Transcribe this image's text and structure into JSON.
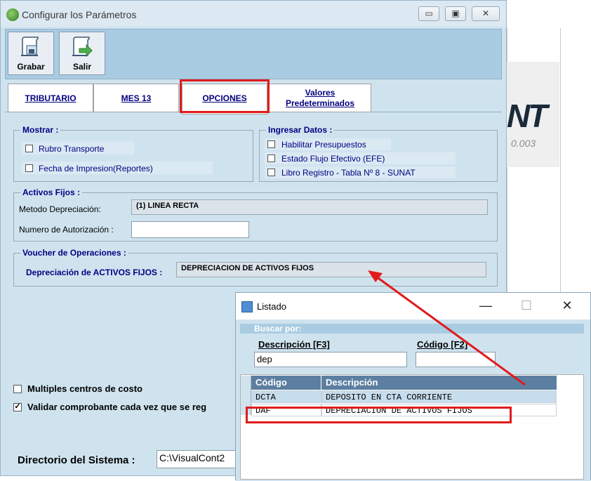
{
  "background_app": {
    "logo_text": "NT",
    "version_text": "0.003"
  },
  "main_window": {
    "title": "Configurar los Parámetros",
    "window_controls": [
      "▭",
      "▣",
      "✕"
    ],
    "toolbar": {
      "save_label": "Grabar",
      "exit_label": "Salir"
    },
    "tabs": [
      {
        "label": "TRIBUTARIO"
      },
      {
        "label": "MES 13"
      },
      {
        "label": "OPCIONES"
      },
      {
        "label_line1": "Valores",
        "label_line2": "Predeterminados"
      }
    ],
    "mostrar": {
      "title": "Mostrar :",
      "items": [
        "Rubro Transporte",
        "Fecha de Impresion(Reportes)"
      ]
    },
    "ingresar_datos": {
      "title": "Ingresar Datos :",
      "items": [
        "Habilitar Presupuestos",
        "Estado Flujo Efectivo (EFE)",
        "Libro Registro - Tabla Nº 8 - SUNAT"
      ]
    },
    "activos_fijos": {
      "title": "Activos Fijos :",
      "metodo_label": "Metodo Depreciación:",
      "metodo_value": "(1) LINEA RECTA",
      "autorizacion_label": "Numero de Autorización :",
      "autorizacion_value": ""
    },
    "voucher": {
      "title": "Voucher de Operaciones :",
      "depreciacion_label": "Depreciación de ACTIVOS FIJOS :",
      "depreciacion_value": "DEPRECIACION DE ACTIVOS FIJOS"
    },
    "options": {
      "multiples_centros": "Multiples centros de costo",
      "validar_comprobante": "Validar comprobante cada vez que se reg"
    },
    "directorio": {
      "label": "Directorio del Sistema :",
      "value": "C:\\VisualCont2"
    }
  },
  "listado_window": {
    "title": "Listado",
    "controls": [
      "—",
      "☐",
      "✕"
    ],
    "search_header": "Buscar por:",
    "descripcion_label": "Descripción [F3]",
    "codigo_label": "Código [F2]",
    "descripcion_value": "dep",
    "codigo_value": "",
    "columns": [
      "Código",
      "Descripción"
    ],
    "rows": [
      {
        "codigo": "DCTA",
        "descripcion": "DEPOSITO EN CTA CORRIENTE"
      },
      {
        "codigo": "DAF",
        "descripcion": "DEPRECIACION DE ACTIVOS FIJOS"
      }
    ]
  },
  "colors": {
    "window_bg": "#cfe3ef",
    "group_title": "#000080",
    "highlight": "#e11b1b",
    "grid_header": "#5c7fa1"
  }
}
